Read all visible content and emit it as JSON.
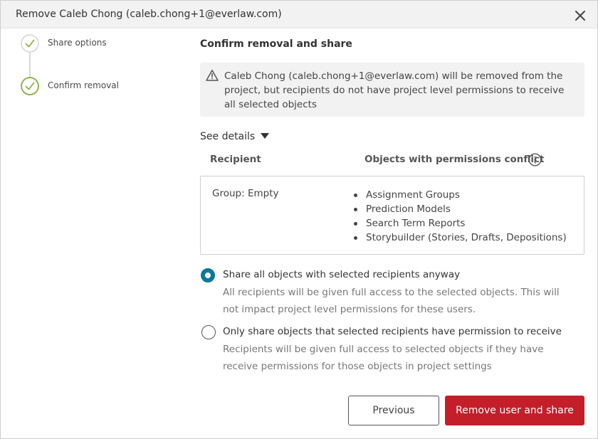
{
  "dialog": {
    "title": "Remove Caleb Chong (caleb.chong+1@everlaw.com)"
  },
  "stepper": {
    "steps": [
      {
        "label": "Share options",
        "state": "complete"
      },
      {
        "label": "Confirm removal",
        "state": "current"
      }
    ]
  },
  "main": {
    "heading": "Confirm removal and share",
    "warning": "Caleb Chong (caleb.chong+1@everlaw.com) will be removed from the project, but recipients do not have project level permissions to receive all selected objects",
    "see_details": "See details",
    "table": {
      "headers": [
        "Recipient",
        "Objects with permissions conflict"
      ],
      "rows": [
        {
          "recipient": "Group: Empty",
          "objects": [
            "Assignment Groups",
            "Prediction Models",
            "Search Term Reports",
            "Storybuilder (Stories, Drafts, Depositions)"
          ]
        }
      ]
    },
    "options": [
      {
        "label": "Share all objects with selected recipients anyway",
        "description": "All recipients will be given full access to the selected objects. This will not impact project level permissions for these users.",
        "selected": true
      },
      {
        "label": "Only share objects that selected recipients have permission to receive",
        "description": "Recipients will be given full access to selected objects if they have receive permissions for those objects in project settings",
        "selected": false
      }
    ]
  },
  "footer": {
    "previous_label": "Previous",
    "remove_label": "Remove user and share"
  },
  "colors": {
    "accent": "#08799a",
    "danger": "#c41e2b",
    "step_complete": "#8cb04a",
    "warning_bg": "#f2f2f2"
  },
  "icons": {
    "close": "close-icon",
    "step_check": "check-icon",
    "warning": "warning-icon",
    "caret": "caret-down-icon",
    "info": "info-icon"
  }
}
